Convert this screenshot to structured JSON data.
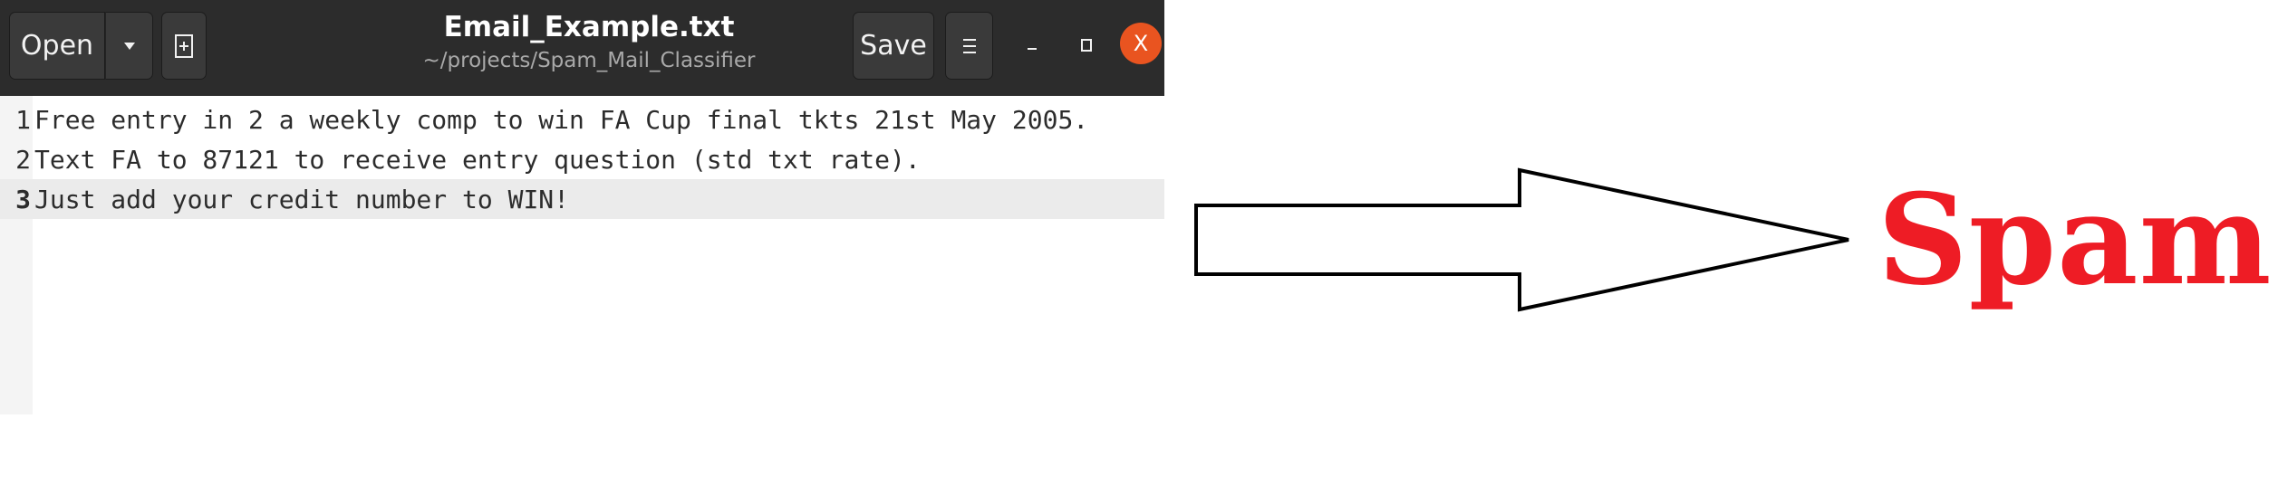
{
  "window": {
    "title": "Email_Example.txt",
    "subtitle": "~/projects/Spam_Mail_Classifier",
    "open_label": "Open",
    "save_label": "Save",
    "close_glyph": "X",
    "icons": {
      "open_menu": "chevron-down-icon",
      "new_document": "new-document-icon",
      "main_menu": "hamburger-menu-icon",
      "minimize": "minimize-icon",
      "maximize": "maximize-icon",
      "close": "close-icon"
    },
    "accent_color": "#e95420",
    "headerbar_color": "#2c2c2c"
  },
  "editor": {
    "current_line": 3,
    "lines": [
      {
        "number": "1",
        "text": "Free entry in 2 a weekly comp to win FA Cup final tkts 21st May 2005."
      },
      {
        "number": "2",
        "text": "Text FA to 87121 to receive entry question (std txt rate)."
      },
      {
        "number": "3",
        "text": "Just add your credit number to WIN!"
      }
    ]
  },
  "classification": {
    "arrow_icon": "right-arrow-icon",
    "label": "Spam",
    "color": "#ee1c25"
  }
}
